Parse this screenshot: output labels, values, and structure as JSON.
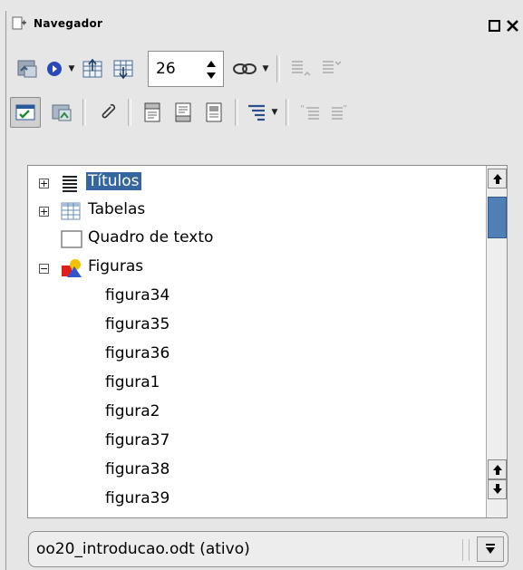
{
  "window": {
    "title": "Navegador",
    "title_icon": "navigator-window-icon",
    "buttons": [
      "restore-button",
      "close-button"
    ]
  },
  "toolbar1": {
    "items": [
      {
        "name": "toggle-content-icon",
        "dropdown": false
      },
      {
        "name": "navigation-icon",
        "dropdown": true
      },
      {
        "name": "previous-item-icon",
        "dropdown": false
      },
      {
        "name": "next-item-icon",
        "dropdown": false
      }
    ],
    "page_number": "26",
    "after": [
      {
        "name": "drag-mode-icon",
        "dropdown": true
      },
      {
        "name": "promote-level-icon",
        "dropdown": false
      },
      {
        "name": "demote-level-icon",
        "dropdown": false
      }
    ]
  },
  "toolbar2": {
    "items": [
      {
        "name": "list-box-toggle-icon",
        "selected": true
      },
      {
        "name": "content-view-icon"
      },
      {
        "name": "reminder-icon"
      },
      {
        "name": "header-icon"
      },
      {
        "name": "footer-icon"
      },
      {
        "name": "anchor-text-icon"
      },
      {
        "name": "heading-levels-icon",
        "dropdown": true
      },
      {
        "name": "promote-chapter-icon"
      },
      {
        "name": "demote-chapter-icon"
      }
    ]
  },
  "tree": {
    "items": [
      {
        "label": "Títulos",
        "icon": "headings-icon",
        "expander": "+",
        "selected": true
      },
      {
        "label": "Tabelas",
        "icon": "tables-icon",
        "expander": "+",
        "selected": false
      },
      {
        "label": "Quadro de texto",
        "icon": "text-frame-icon",
        "expander": "",
        "selected": false
      },
      {
        "label": "Figuras",
        "icon": "figures-icon",
        "expander": "−",
        "selected": false
      }
    ],
    "children": [
      "figura34",
      "figura35",
      "figura36",
      "figura1",
      "figura2",
      "figura37",
      "figura38",
      "figura39"
    ]
  },
  "document_select": {
    "value": "oo20_introducao.odt (ativo)"
  }
}
